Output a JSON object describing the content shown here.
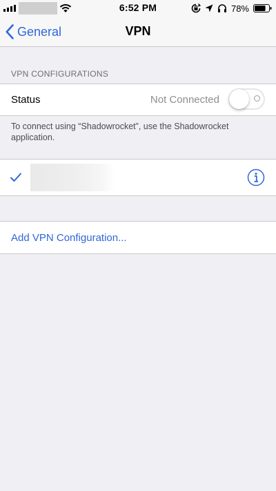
{
  "status_bar": {
    "time": "6:52 PM",
    "battery_percent": "78%",
    "icons": [
      "signal-bars-icon",
      "wifi-icon",
      "rotation-lock-icon",
      "location-arrow-icon",
      "headphones-icon",
      "battery-icon"
    ]
  },
  "nav": {
    "back_label": "General",
    "title": "VPN"
  },
  "vpn_section": {
    "header": "VPN CONFIGURATIONS",
    "status_label": "Status",
    "status_value": "Not Connected",
    "toggle_on": false,
    "footer": "To connect using “Shadowrocket”, use the Shadowrocket application."
  },
  "configuration": {
    "selected": true
  },
  "add_configuration_label": "Add VPN Configuration...",
  "colors": {
    "accent": "#2f67d8",
    "background": "#efeff4",
    "secondary_text": "#8e8e93"
  }
}
